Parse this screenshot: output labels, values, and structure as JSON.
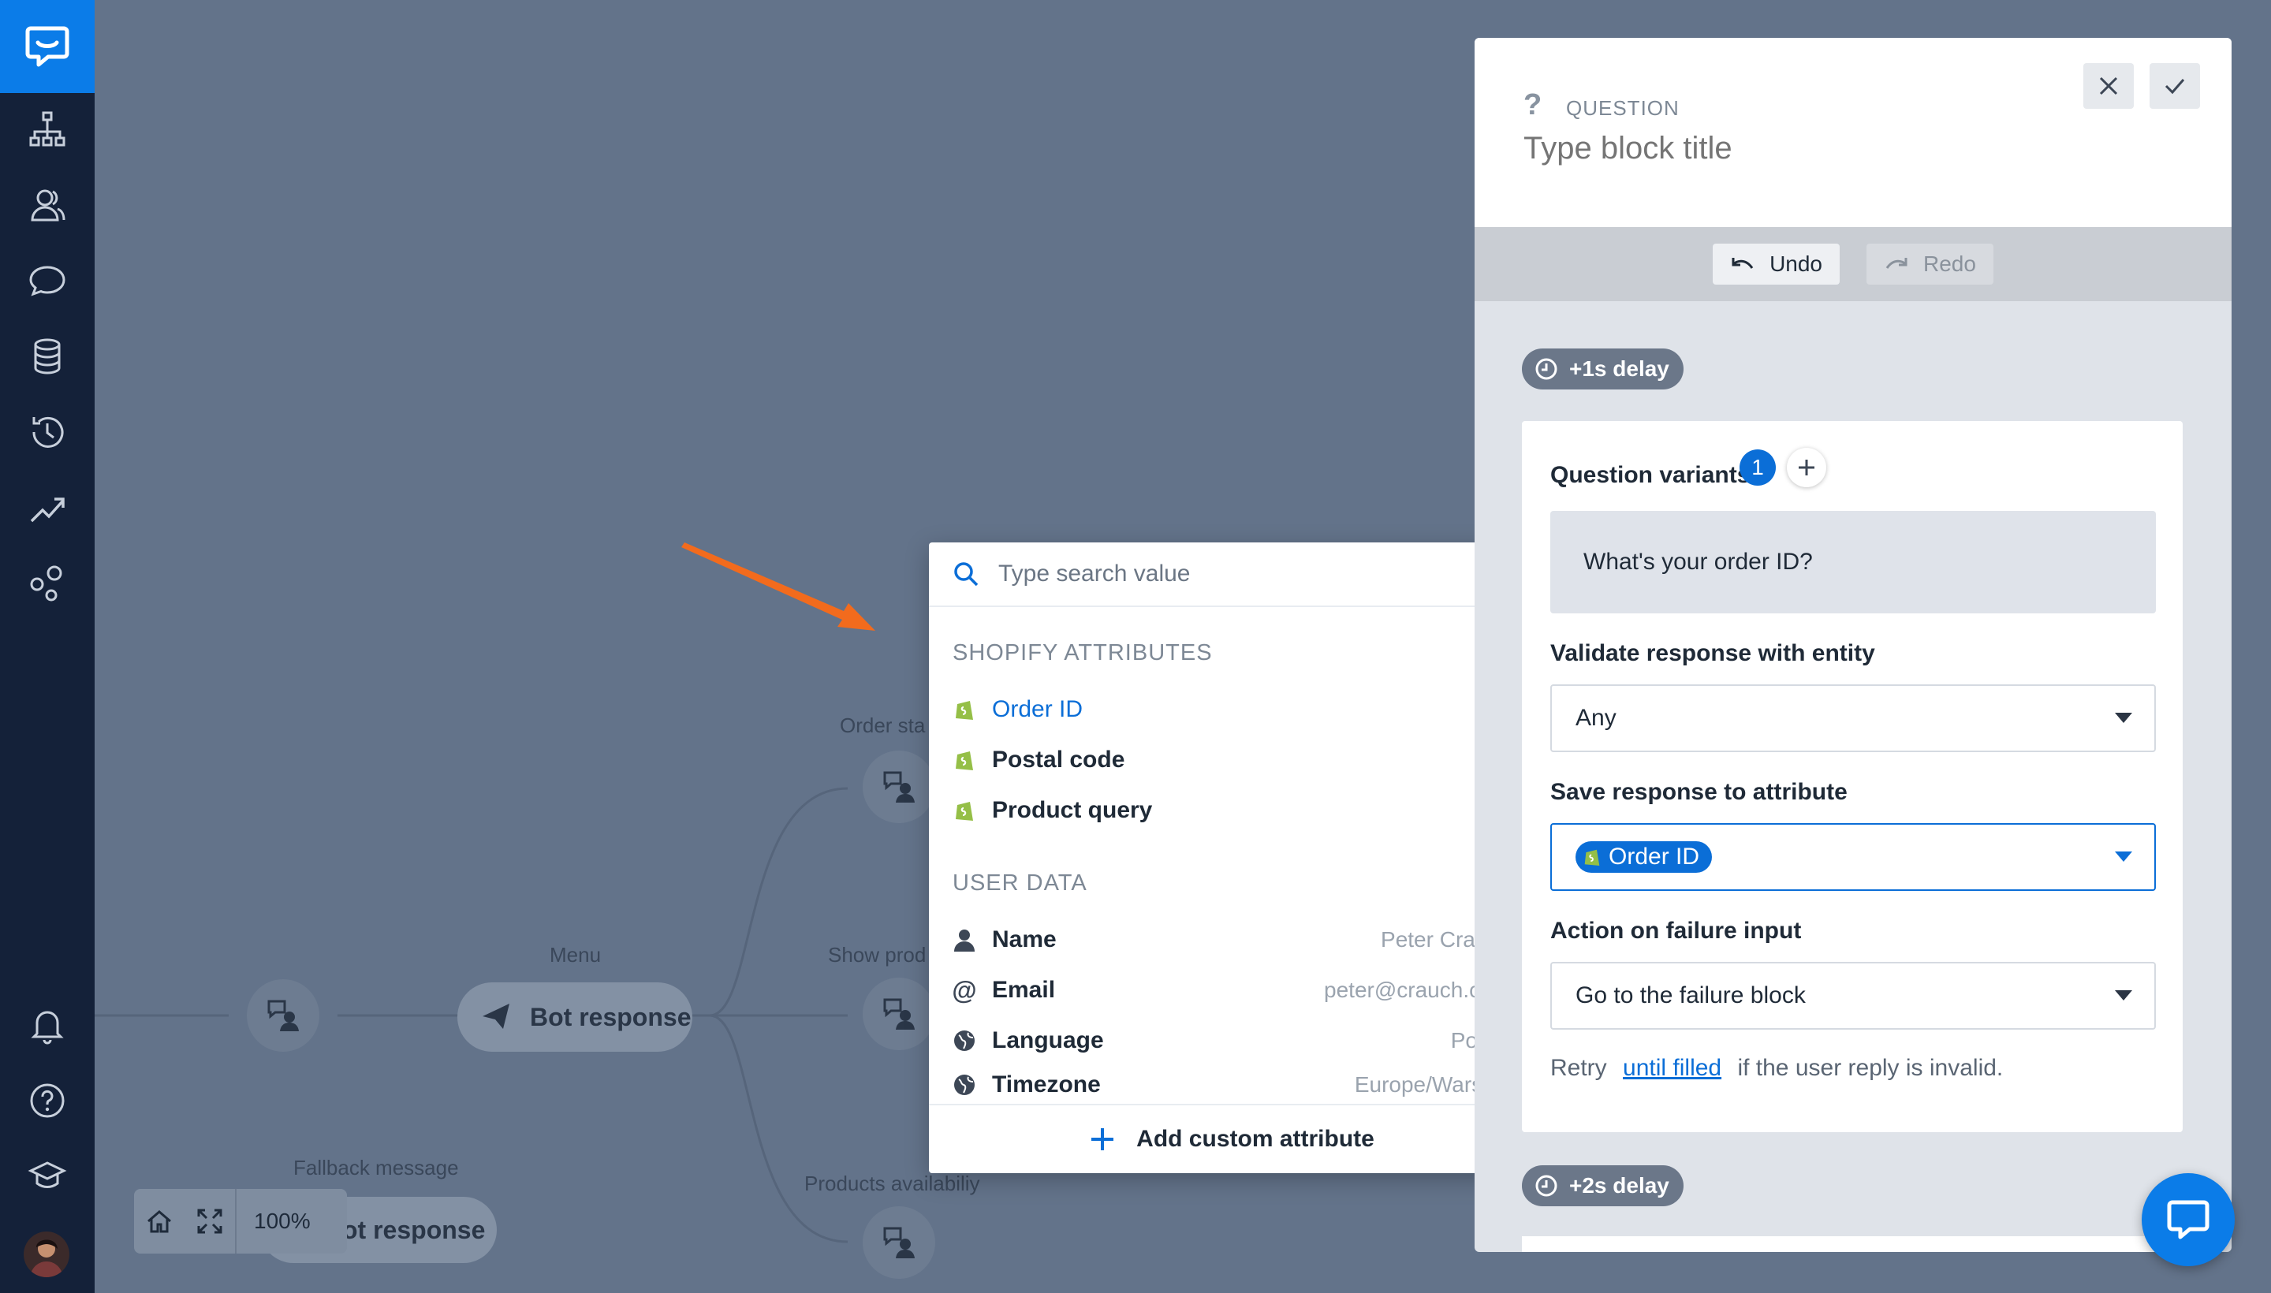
{
  "canvas": {
    "nodes": [
      {
        "label": "Menu"
      },
      {
        "label": "Order sta"
      },
      {
        "label": "Show prod"
      },
      {
        "label": "Products availabiliy"
      },
      {
        "label": "Fallback message"
      }
    ],
    "menu_pill": "Bot response",
    "fallback_pill": "ot response",
    "zoom_level": "100%"
  },
  "dropdown": {
    "search_placeholder": "Type search value",
    "sections": [
      {
        "title": "SHOPIFY ATTRIBUTES",
        "items": [
          {
            "label": "Order ID",
            "selected": true
          },
          {
            "label": "Postal code"
          },
          {
            "label": "Product query"
          }
        ]
      },
      {
        "title": "USER DATA",
        "items": [
          {
            "label": "Name",
            "value": "Peter Crauch",
            "icon": "user-icon"
          },
          {
            "label": "Email",
            "value": "peter@crauch.com",
            "icon": "at-icon"
          },
          {
            "label": "Language",
            "value": "Polish",
            "icon": "globe-icon"
          },
          {
            "label": "Timezone",
            "value": "Europe/Warsaw",
            "icon": "globe-icon"
          }
        ]
      }
    ],
    "footer": "Add custom attribute"
  },
  "panel": {
    "type_label": "QUESTION",
    "title_placeholder": "Type block title",
    "undo": "Undo",
    "redo": "Redo",
    "delay1": "+1s delay",
    "delay2": "+2s delay",
    "variants_label": "Question variants",
    "variants_count": "1",
    "variant_text": "What's your order ID?",
    "validate_label": "Validate response with entity",
    "validate_value": "Any",
    "save_label": "Save response to attribute",
    "save_value": "Order ID",
    "failure_label": "Action on failure input",
    "failure_value": "Go to the failure block",
    "retry_prefix": "Retry",
    "retry_link": "until filled",
    "retry_suffix": "if the user reply is invalid."
  },
  "colors": {
    "accent": "#0b7ce8",
    "sidebar": "#142139",
    "canvas": "#63738a",
    "arrow": "#f26b1d"
  }
}
